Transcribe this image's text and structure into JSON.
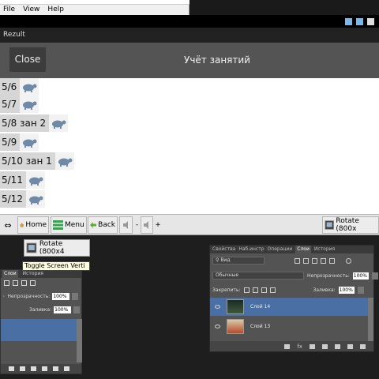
{
  "host": {
    "menu": [
      {
        "label": "File",
        "accel": "F"
      },
      {
        "label": "View",
        "accel": "V"
      },
      {
        "label": "Help",
        "accel": "H"
      }
    ]
  },
  "app": {
    "window_title": "Rezult",
    "close_label": "Close",
    "heading": "Учёт занятий",
    "rows": [
      {
        "label": "5/6",
        "icon": "turtle-icon"
      },
      {
        "label": "5/7",
        "icon": "turtle-icon"
      },
      {
        "label": "5/8 зан 2",
        "icon": "turtle-icon"
      },
      {
        "label": "5/9",
        "icon": "turtle-icon"
      },
      {
        "label": "5/10 зан 1",
        "icon": "turtle-icon"
      },
      {
        "label": "5/11",
        "icon": "turtle-icon"
      },
      {
        "label": "5/12",
        "icon": "turtle-icon"
      }
    ]
  },
  "toolbar": {
    "home_label": "Home",
    "home_accel": "H",
    "menu_label": "Menu",
    "back_label": "Back",
    "back_accel": "B",
    "minus_label": "-",
    "plus_label": "+",
    "rotate_label": "Rotate (800x",
    "arrows_label": "⇔"
  },
  "rotate_button2": "Rotate (800x4",
  "tooltip": "Toggle Screen Verti",
  "left_panel": {
    "tabs": [
      "Слои",
      "История"
    ],
    "opacity_label": "Непрозрачность:",
    "opacity_value": "100%",
    "fill_label": "Заливка:",
    "fill_value": "100%"
  },
  "ps_panel": {
    "tabs": [
      "Свойства",
      "Наб.инстр",
      "Операции",
      "Слои",
      "История"
    ],
    "active_tab": "Слои",
    "kind_label": "Вид",
    "blend_label": "Обычные",
    "opacity_label": "Непрозрачность:",
    "opacity_value": "100%",
    "lock_label": "Закрепить:",
    "fill_label": "Заливка:",
    "fill_value": "100%",
    "layers": [
      "Слой 14",
      "Слой 13"
    ],
    "fx_label": "fx"
  },
  "colors": {
    "header": "#545454",
    "close_button": "#3c3c3c",
    "row_label_bg": "#d6d6d6",
    "selection": "#4a6fa5"
  }
}
